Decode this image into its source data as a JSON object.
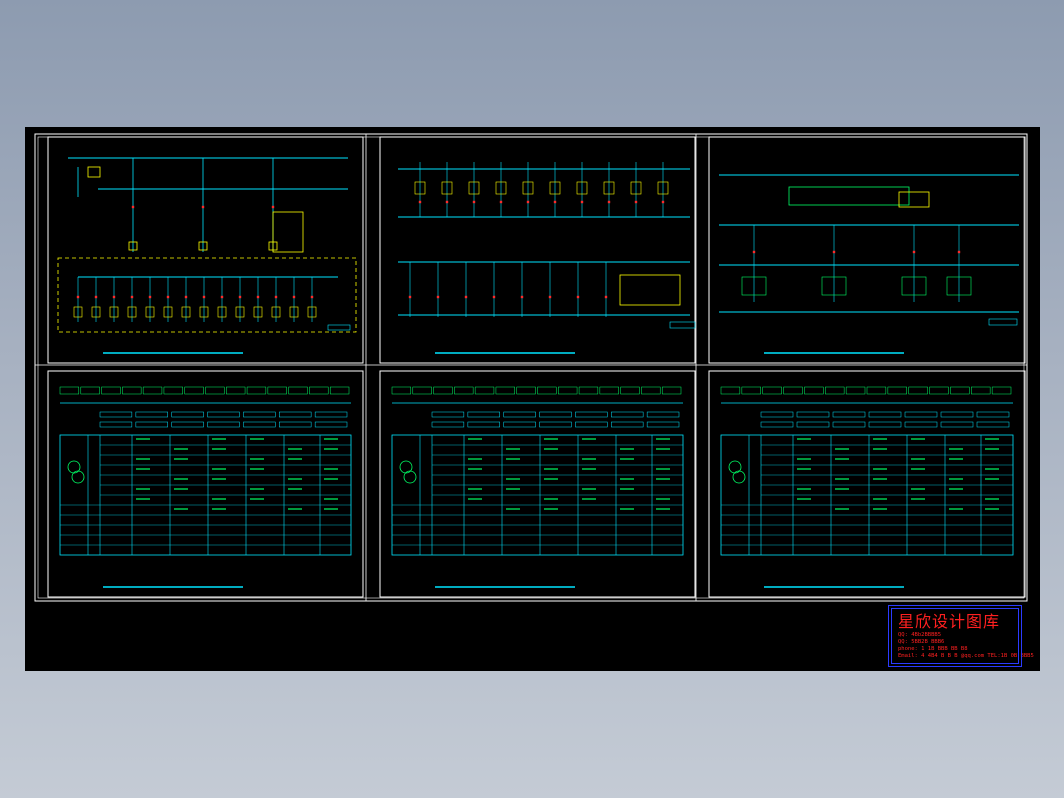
{
  "viewer": {
    "background_color": "#000000",
    "frame_color": "#ffffff",
    "line_colors": {
      "bus": "#00e5ff",
      "breaker": "#ff2a2a",
      "device": "#ffff00",
      "table": "#00ff66"
    }
  },
  "drawing": {
    "sheets": [
      {
        "kind": "schematic"
      },
      {
        "kind": "schematic"
      },
      {
        "kind": "schematic"
      },
      {
        "kind": "table"
      },
      {
        "kind": "table"
      },
      {
        "kind": "table"
      }
    ]
  },
  "stamp": {
    "title": "星欣设计图库",
    "lines": [
      "QQ: 4Bb2BBBB5",
      "QQ: 5BB2B BBB6",
      "phone: 1 1B BBB BB B8",
      "Email: 4 4B4 B B B @qq.com  TEL:1B 0B BBB5"
    ]
  }
}
